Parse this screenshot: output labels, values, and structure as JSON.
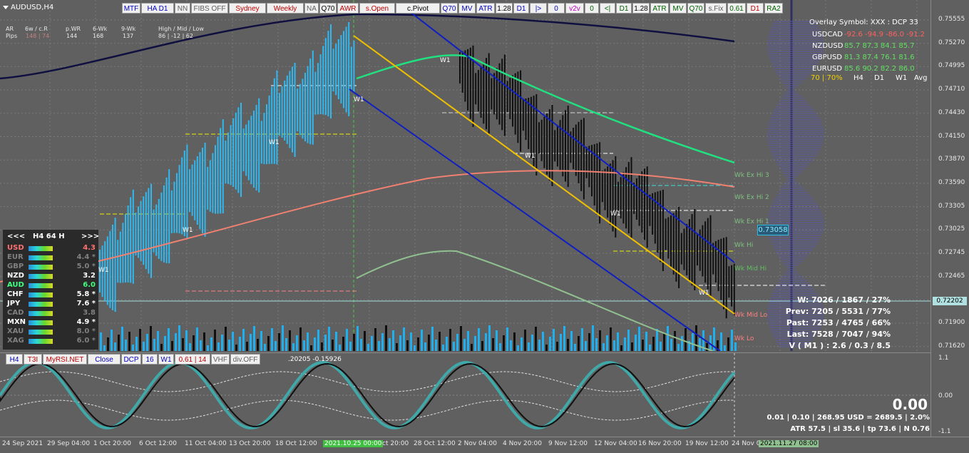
{
  "symbol_title": "AUDUSD,H4",
  "top_toolbar": [
    {
      "label": "MTF",
      "color": "#0000c0"
    },
    {
      "label": "HA D1",
      "color": "#0000c0"
    },
    {
      "label": "NN",
      "color": "#606060"
    },
    {
      "label": "FIBS OFF",
      "color": "#606060"
    },
    {
      "label": "Sydney",
      "color": "#c00000"
    },
    {
      "label": "Weekly",
      "color": "#c00000"
    },
    {
      "label": "NA",
      "color": "#606060"
    },
    {
      "label": "Q70",
      "color": "#000000"
    },
    {
      "label": "AWR",
      "color": "#c00000"
    },
    {
      "label": "s.Open",
      "color": "#c00000"
    },
    {
      "label": "c.Pivot",
      "color": "#000000"
    },
    {
      "label": "Q70",
      "color": "#0000c0"
    },
    {
      "label": "MV",
      "color": "#0000c0"
    },
    {
      "label": "ATR",
      "color": "#0000c0"
    },
    {
      "label": "1.28",
      "color": "#000000"
    },
    {
      "label": "D1",
      "color": "#0000c0"
    },
    {
      "label": "|>",
      "color": "#0000c0"
    },
    {
      "label": "0",
      "color": "#0000c0"
    },
    {
      "label": "v2v",
      "color": "#c000c0"
    },
    {
      "label": "0",
      "color": "#006000"
    },
    {
      "label": "<|",
      "color": "#006000"
    },
    {
      "label": "D1",
      "color": "#006000"
    },
    {
      "label": "1.28",
      "color": "#000000"
    },
    {
      "label": "ATR",
      "color": "#006000"
    },
    {
      "label": "MV",
      "color": "#006000"
    },
    {
      "label": "Q70",
      "color": "#006000"
    },
    {
      "label": "s.Fix",
      "color": "#606060"
    },
    {
      "label": "0.61",
      "color": "#006000"
    },
    {
      "label": "D1",
      "color": "#c00000"
    },
    {
      "label": "RA2",
      "color": "#006000"
    }
  ],
  "stats_header": {
    "row1": [
      "AR",
      "6w / c.R",
      "p.WR",
      "6-Wk",
      "9-Wk",
      "High / Mid / Low"
    ],
    "row2_label": "Pips",
    "row2_values": [
      "148 | 74",
      "144",
      "168",
      "137",
      "86  |  -12  |  62"
    ]
  },
  "overlay": {
    "title": "Overlay Symbol: XXX : DCP 33",
    "rows": [
      {
        "sym": "USDCAD",
        "vals": "-92.6  -94.9  -86.0  -91.2",
        "color": "#ff6060"
      },
      {
        "sym": "NZDUSD",
        "vals": "85.7  87.3  84.1  85.7",
        "color": "#60e060"
      },
      {
        "sym": "GBPUSD",
        "vals": "81.3  87.4  76.1  81.6",
        "color": "#60e060"
      },
      {
        "sym": "EURUSD",
        "vals": "85.6  90.2  82.2  86.0",
        "color": "#60e060"
      }
    ],
    "footer_pct": "70 | 70%",
    "footer_cols": [
      "H4",
      "D1",
      "W1",
      "Avg"
    ]
  },
  "currency_panel": {
    "header_left": "<<<",
    "header_mid": "H4  64  H",
    "header_right": ">>>",
    "rows": [
      {
        "name": "USD",
        "val": "4.3",
        "color": "#ff7070"
      },
      {
        "name": "EUR",
        "val": "4.4 *",
        "color": "#808080"
      },
      {
        "name": "GBP",
        "val": "5.0 *",
        "color": "#808080"
      },
      {
        "name": "NZD",
        "val": "3.2",
        "color": "#ffffff"
      },
      {
        "name": "AUD",
        "val": "6.0",
        "color": "#40ff80"
      },
      {
        "name": "CHF",
        "val": "5.8 *",
        "color": "#ffffff"
      },
      {
        "name": "JPY",
        "val": "7.6 *",
        "color": "#ffffff"
      },
      {
        "name": "CAD",
        "val": "3.8",
        "color": "#808080"
      },
      {
        "name": "MXN",
        "val": "4.9 *",
        "color": "#ffffff"
      },
      {
        "name": "XAU",
        "val": "8.0 *",
        "color": "#808080"
      },
      {
        "name": "XAG",
        "val": "6.0 *",
        "color": "#808080"
      }
    ]
  },
  "level_labels": [
    {
      "text": "Wk Ex Hi 3",
      "color": "#80c080"
    },
    {
      "text": "Wk Ex Hi 2",
      "color": "#80c080"
    },
    {
      "text": "Wk Ex Hi 1",
      "color": "#80c080"
    },
    {
      "text": "Wk Hi",
      "color": "#80c080"
    },
    {
      "text": "Wk Mid Hi",
      "color": "#60c060"
    },
    {
      "text": "Wk Mid Lo",
      "color": "#ff8080"
    },
    {
      "text": "Wk Lo",
      "color": "#ff8080"
    }
  ],
  "price_box": "0.73058",
  "w1_labels": [
    "W1",
    "W1",
    "W1",
    "W1",
    "W1",
    "W1",
    "W1",
    "W1"
  ],
  "right_stats": [
    "W: 7026 / 1867 / 27%",
    "Prev: 7205 / 5531 / 77%",
    "Past: 7253 / 4765 / 66%",
    "Last: 7528 / 7047 / 94%",
    "V ( M1 ) : 2.6 / 0.3 / 8.5"
  ],
  "price_ticks": [
    "0.75555",
    "0.75270",
    "0.74995",
    "0.74710",
    "0.74430",
    "0.74150",
    "0.73870",
    "0.73590",
    "0.73305",
    "0.73025",
    "0.72745",
    "0.72465",
    "0.72202",
    "0.71900",
    "0.71620"
  ],
  "current_price": "0.72202",
  "sub_toolbar": [
    {
      "label": "H4",
      "color": "#0000c0"
    },
    {
      "label": "T3I",
      "color": "#c00000"
    },
    {
      "label": "MyRSI.NET",
      "color": "#c00000"
    },
    {
      "label": "Close",
      "color": "#0000c0"
    },
    {
      "label": "DCP",
      "color": "#0000c0"
    },
    {
      "label": "16",
      "color": "#0000c0"
    },
    {
      "label": "W1",
      "color": "#0000c0"
    },
    {
      "label": "0.61 | 14",
      "color": "#c00000"
    },
    {
      "label": "VHF",
      "color": "#606060"
    },
    {
      "label": "div.OFF",
      "color": "#606060"
    }
  ],
  "sub_readout": ".20205 -0.15926",
  "sub_big_value": "0.00",
  "sub_stats1": "0.01   |   0.10   |  268.95 USD = 2689.5   |   2.0%",
  "sub_stats2": "ATR 57.5   |  sl 35.6   |   tp 73.6   |   N 0.76",
  "sub_ticks": [
    "1.1",
    "0.00",
    "-1.1"
  ],
  "time_ticks": [
    "24 Sep 2021",
    "29 Sep 04:00",
    "1 Oct 20:00",
    "6 Oct 12:00",
    "11 Oct 04:00",
    "13 Oct 20:00",
    "18 Oct 12:00",
    "2021.10.25 00:00",
    "ct 20:00",
    "28 Oct 12:00",
    "2 Nov 04:00",
    "4 Nov 20:00",
    "9 Nov 12:00",
    "12 Nov 04:00",
    "16 Nov 20:00",
    "19 Nov 12:00",
    "24 Nov 0",
    "2021.11.27 08:00"
  ]
}
